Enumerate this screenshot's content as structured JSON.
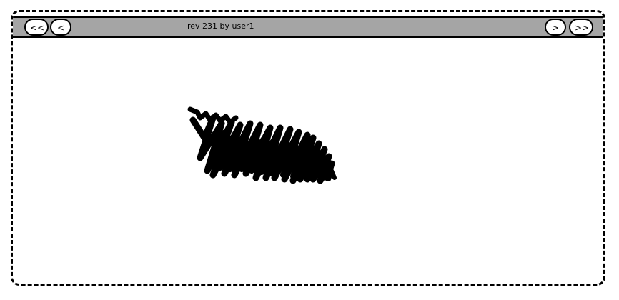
{
  "toolbar": {
    "first_label": "<<",
    "prev_label": "<",
    "next_label": ">",
    "last_label": ">>",
    "revision_text": "rev 231 by user1"
  },
  "colors": {
    "toolbar_bg": "#a5a5a5",
    "ink": "#000000",
    "background": "#ffffff"
  },
  "canvas": {
    "content": "scribble-drawing"
  }
}
